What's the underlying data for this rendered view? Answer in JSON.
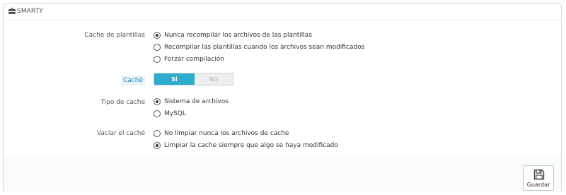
{
  "panel": {
    "title": "SMARTY",
    "icon": "briefcase-icon"
  },
  "fields": {
    "template_cache": {
      "label": "Cache de plantillas",
      "options": [
        {
          "label": "Nunca recompilar los archivos de las plantillas",
          "checked": true
        },
        {
          "label": "Recompilar las plantillas cuando los archivos sean modificados",
          "checked": false
        },
        {
          "label": "Forzar compilación",
          "checked": false
        }
      ]
    },
    "cache": {
      "label": "Caché",
      "on_label": "SÍ",
      "off_label": "NO",
      "value": "on"
    },
    "cache_type": {
      "label": "Tipo de cache",
      "options": [
        {
          "label": "Sistema de archivos",
          "checked": true
        },
        {
          "label": "MySQL",
          "checked": false
        }
      ]
    },
    "clear_cache": {
      "label": "Vaciar el caché",
      "options": [
        {
          "label": "No limpiar nunca los archivos de cache",
          "checked": false
        },
        {
          "label": "Limpiar la cache siempre que algo se haya modificado",
          "checked": true
        }
      ]
    }
  },
  "footer": {
    "save_label": "Guardar",
    "save_icon": "floppy-disk-icon"
  },
  "colors": {
    "switch_on": "#2eacce",
    "label_badge_bg": "#e6f3fa",
    "label_badge_text": "#2a82b6"
  }
}
